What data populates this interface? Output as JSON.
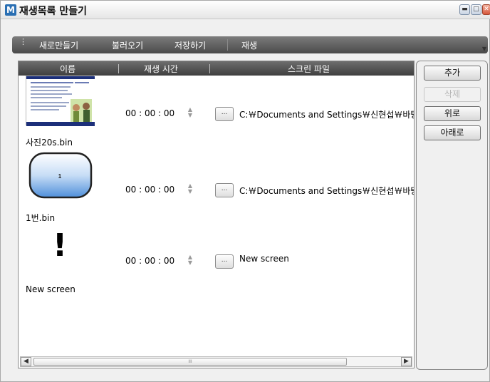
{
  "window": {
    "title": "재생목록 만들기",
    "icon_letter": "M"
  },
  "toolbar": {
    "items": [
      "새로만들기",
      "불러오기",
      "저장하기",
      "재생"
    ]
  },
  "columns": {
    "name": "이름",
    "duration": "재생 시간",
    "file": "스크린 파일"
  },
  "rows": [
    {
      "name": "사진20s.bin",
      "time": "00 : 00 : 00",
      "path": "C:￦Documents and Settings￦신현섭￦바탕"
    },
    {
      "name": "1번.bin",
      "time": "00 : 00 : 00",
      "path": "C:￦Documents and Settings￦신현섭￦바탕",
      "thumb_label": "1"
    },
    {
      "name": "New screen",
      "time": "00 : 00 : 00",
      "path": "New screen",
      "thumb_label": "!"
    }
  ],
  "buttons": {
    "add": "추가",
    "delete": "삭제",
    "up": "위로",
    "down": "아래로"
  },
  "browse_label": "...",
  "scroll_grip": "III",
  "colors": {
    "toolbar": "#5a5a5a",
    "header": "#4a4a4a",
    "accent": "#2a6fb3"
  }
}
